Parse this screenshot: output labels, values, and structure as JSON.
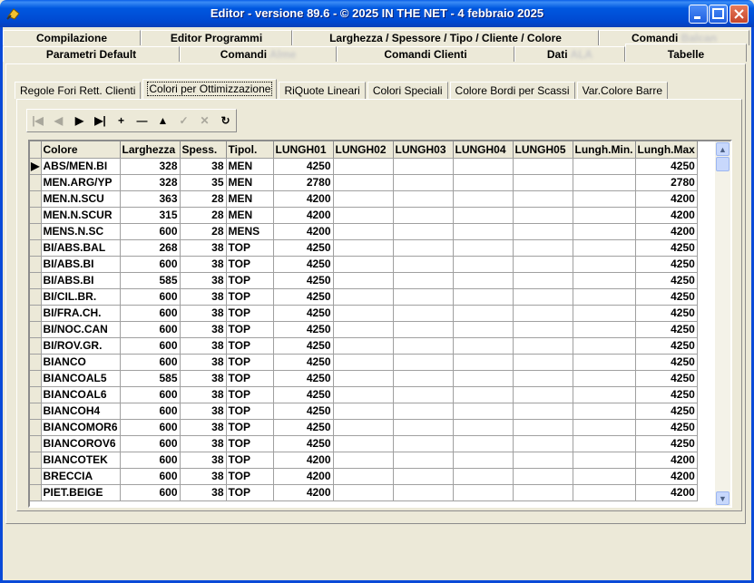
{
  "window": {
    "title": "Editor - versione 89.6 - © 2025  IN THE NET - 4 febbraio 2025"
  },
  "tabs_row1": [
    {
      "label": "Compilazione"
    },
    {
      "label": "Editor Programmi"
    },
    {
      "label": "Larghezza / Spessore / Tipo / Cliente / Colore"
    },
    {
      "label": "Comandi",
      "blurred": "Balcan"
    }
  ],
  "tabs_row2": [
    {
      "label": "Parametri Default"
    },
    {
      "label": "Comandi",
      "blurred": "Alme"
    },
    {
      "label": "Comandi Clienti"
    },
    {
      "label": "Dati",
      "blurred": "ALA"
    },
    {
      "label": "Tabelle"
    }
  ],
  "subtabs": [
    {
      "label": "Regole Fori Rett. Clienti"
    },
    {
      "label": "Colori per Ottimizzazione"
    },
    {
      "label": "RiQuote Lineari"
    },
    {
      "label": "Colori Speciali"
    },
    {
      "label": "Colore Bordi per Scassi"
    },
    {
      "label": "Var.Colore Barre"
    }
  ],
  "navigator": [
    {
      "icon": "first-record-icon",
      "glyph": "|◀",
      "enabled": false
    },
    {
      "icon": "prior-record-icon",
      "glyph": "◀",
      "enabled": false
    },
    {
      "icon": "next-record-icon",
      "glyph": "▶",
      "enabled": true
    },
    {
      "icon": "last-record-icon",
      "glyph": "▶|",
      "enabled": true
    },
    {
      "icon": "insert-record-icon",
      "glyph": "+",
      "enabled": true
    },
    {
      "icon": "delete-record-icon",
      "glyph": "—",
      "enabled": true
    },
    {
      "icon": "edit-record-icon",
      "glyph": "▲",
      "enabled": true
    },
    {
      "icon": "post-record-icon",
      "glyph": "✓",
      "enabled": false
    },
    {
      "icon": "cancel-record-icon",
      "glyph": "✕",
      "enabled": false
    },
    {
      "icon": "refresh-record-icon",
      "glyph": "↻",
      "enabled": true
    }
  ],
  "grid": {
    "columns": [
      "Colore",
      "Larghezza",
      "Spess.",
      "Tipol.",
      "LUNGH01",
      "LUNGH02",
      "LUNGH03",
      "LUNGH04",
      "LUNGH05",
      "Lungh.Min.",
      "Lungh.Max"
    ],
    "rows": [
      [
        "ABS/MEN.BI",
        "328",
        "38",
        "MEN",
        "4250",
        "",
        "",
        "",
        "",
        "",
        "4250"
      ],
      [
        "MEN.ARG/YP",
        "328",
        "35",
        "MEN",
        "2780",
        "",
        "",
        "",
        "",
        "",
        "2780"
      ],
      [
        "MEN.N.SCU",
        "363",
        "28",
        "MEN",
        "4200",
        "",
        "",
        "",
        "",
        "",
        "4200"
      ],
      [
        "MEN.N.SCUR",
        "315",
        "28",
        "MEN",
        "4200",
        "",
        "",
        "",
        "",
        "",
        "4200"
      ],
      [
        "MENS.N.SC",
        "600",
        "28",
        "MENS",
        "4200",
        "",
        "",
        "",
        "",
        "",
        "4200"
      ],
      [
        "BI/ABS.BAL",
        "268",
        "38",
        "TOP",
        "4250",
        "",
        "",
        "",
        "",
        "",
        "4250"
      ],
      [
        "BI/ABS.BI",
        "600",
        "38",
        "TOP",
        "4250",
        "",
        "",
        "",
        "",
        "",
        "4250"
      ],
      [
        "BI/ABS.BI",
        "585",
        "38",
        "TOP",
        "4250",
        "",
        "",
        "",
        "",
        "",
        "4250"
      ],
      [
        "BI/CIL.BR.",
        "600",
        "38",
        "TOP",
        "4250",
        "",
        "",
        "",
        "",
        "",
        "4250"
      ],
      [
        "BI/FRA.CH.",
        "600",
        "38",
        "TOP",
        "4250",
        "",
        "",
        "",
        "",
        "",
        "4250"
      ],
      [
        "BI/NOC.CAN",
        "600",
        "38",
        "TOP",
        "4250",
        "",
        "",
        "",
        "",
        "",
        "4250"
      ],
      [
        "BI/ROV.GR.",
        "600",
        "38",
        "TOP",
        "4250",
        "",
        "",
        "",
        "",
        "",
        "4250"
      ],
      [
        "BIANCO",
        "600",
        "38",
        "TOP",
        "4250",
        "",
        "",
        "",
        "",
        "",
        "4250"
      ],
      [
        "BIANCOAL5",
        "585",
        "38",
        "TOP",
        "4250",
        "",
        "",
        "",
        "",
        "",
        "4250"
      ],
      [
        "BIANCOAL6",
        "600",
        "38",
        "TOP",
        "4250",
        "",
        "",
        "",
        "",
        "",
        "4250"
      ],
      [
        "BIANCOH4",
        "600",
        "38",
        "TOP",
        "4250",
        "",
        "",
        "",
        "",
        "",
        "4250"
      ],
      [
        "BIANCOMOR6",
        "600",
        "38",
        "TOP",
        "4250",
        "",
        "",
        "",
        "",
        "",
        "4250"
      ],
      [
        "BIANCOROV6",
        "600",
        "38",
        "TOP",
        "4250",
        "",
        "",
        "",
        "",
        "",
        "4250"
      ],
      [
        "BIANCOTEK",
        "600",
        "38",
        "TOP",
        "4200",
        "",
        "",
        "",
        "",
        "",
        "4200"
      ],
      [
        "BRECCIA",
        "600",
        "38",
        "TOP",
        "4200",
        "",
        "",
        "",
        "",
        "",
        "4200"
      ],
      [
        "PIET.BEIGE",
        "600",
        "38",
        "TOP",
        "4200",
        "",
        "",
        "",
        "",
        "",
        "4200"
      ]
    ],
    "current_row_indicator": "▶"
  },
  "colors": {
    "titlebar": "#0048d0",
    "face": "#ece9d8"
  }
}
